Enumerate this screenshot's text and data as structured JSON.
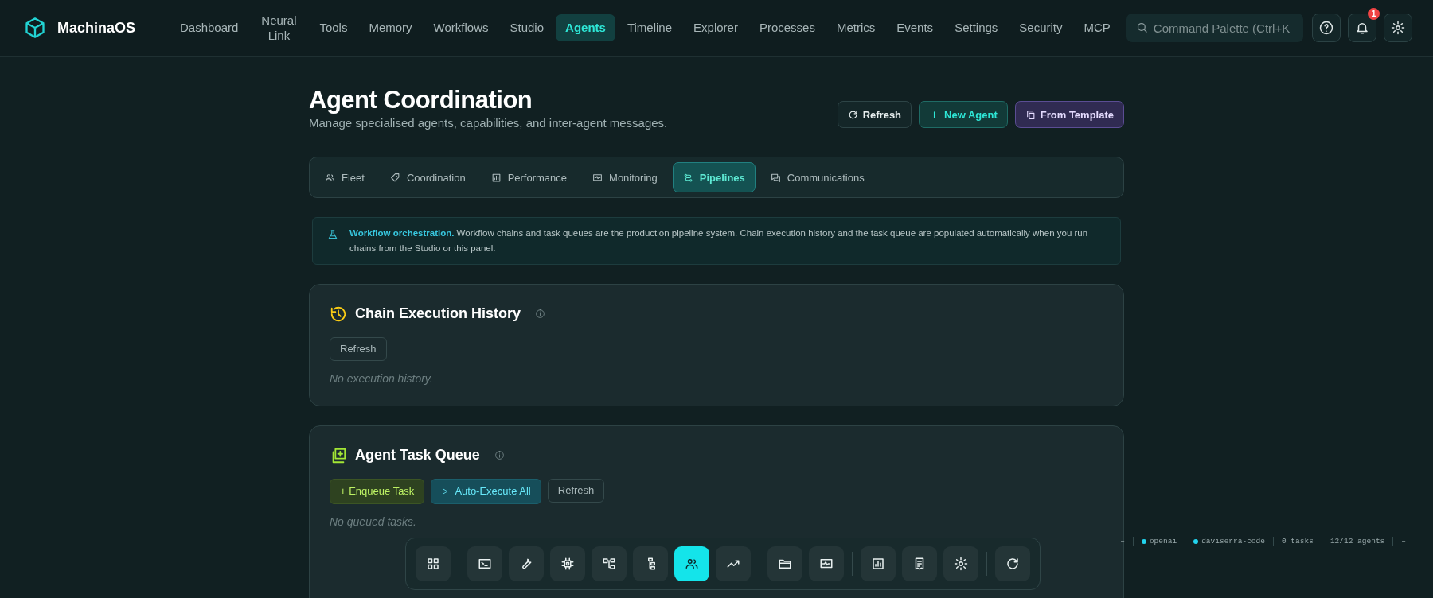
{
  "app": {
    "name": "MachinaOS"
  },
  "nav": [
    {
      "label": "Dashboard",
      "selected": false
    },
    {
      "label": "Neural Link",
      "selected": false
    },
    {
      "label": "Tools",
      "selected": false
    },
    {
      "label": "Memory",
      "selected": false
    },
    {
      "label": "Workflows",
      "selected": false
    },
    {
      "label": "Studio",
      "selected": false
    },
    {
      "label": "Agents",
      "selected": true
    },
    {
      "label": "Timeline",
      "selected": false
    },
    {
      "label": "Explorer",
      "selected": false
    },
    {
      "label": "Processes",
      "selected": false
    },
    {
      "label": "Metrics",
      "selected": false
    },
    {
      "label": "Events",
      "selected": false
    },
    {
      "label": "Settings",
      "selected": false
    },
    {
      "label": "Security",
      "selected": false
    },
    {
      "label": "MCP",
      "selected": false
    }
  ],
  "search": {
    "placeholder": "Command Palette (Ctrl+K"
  },
  "notifications": {
    "count": "1"
  },
  "page": {
    "title": "Agent Coordination",
    "subtitle": "Manage specialised agents, capabilities, and inter-agent messages."
  },
  "actions": [
    {
      "label": "Refresh",
      "kind": "refresh"
    },
    {
      "label": "New Agent",
      "kind": "create"
    },
    {
      "label": "From Template",
      "kind": "template"
    }
  ],
  "tabs": [
    {
      "label": "Fleet",
      "selected": false
    },
    {
      "label": "Coordination",
      "selected": false
    },
    {
      "label": "Performance",
      "selected": false
    },
    {
      "label": "Monitoring",
      "selected": false
    },
    {
      "label": "Pipelines",
      "selected": true
    },
    {
      "label": "Communications",
      "selected": false
    }
  ],
  "banner": {
    "text": "**Workflow orchestration.** Workflow chains and task queues are the production pipeline system. Chain execution history and the task queue are populated automatically when you run chains from the Studio or this panel."
  },
  "panels": [
    {
      "title": "Chain Execution History",
      "buttons": [
        {
          "label": "Refresh",
          "kind": "plain"
        }
      ],
      "empty": "No execution history."
    },
    {
      "title": "Agent Task Queue",
      "buttons": [
        {
          "label": "+ Enqueue Task",
          "kind": "enqueue"
        },
        {
          "label": "Auto-Execute All",
          "kind": "run"
        },
        {
          "label": "Refresh",
          "kind": "plain"
        }
      ],
      "empty": "No queued tasks."
    }
  ],
  "dock": [
    [
      {
        "selected": false
      }
    ],
    [
      {
        "selected": false
      },
      {
        "selected": false
      },
      {
        "selected": false
      },
      {
        "selected": false
      },
      {
        "selected": false
      },
      {
        "selected": true
      },
      {
        "selected": false
      }
    ],
    [
      {
        "selected": false
      },
      {
        "selected": false
      }
    ],
    [
      {
        "selected": false
      },
      {
        "selected": false
      },
      {
        "selected": false
      }
    ],
    [
      {
        "selected": false
      }
    ]
  ],
  "status": [
    {
      "text": "–",
      "kind": "plain"
    },
    {
      "text": "openai",
      "kind": "dot"
    },
    {
      "text": "daviserra-code",
      "kind": "dot"
    },
    {
      "text": "0 tasks",
      "kind": "plain"
    },
    {
      "text": "12/12 agents",
      "kind": "plain"
    },
    {
      "text": "–",
      "kind": "plain"
    }
  ]
}
